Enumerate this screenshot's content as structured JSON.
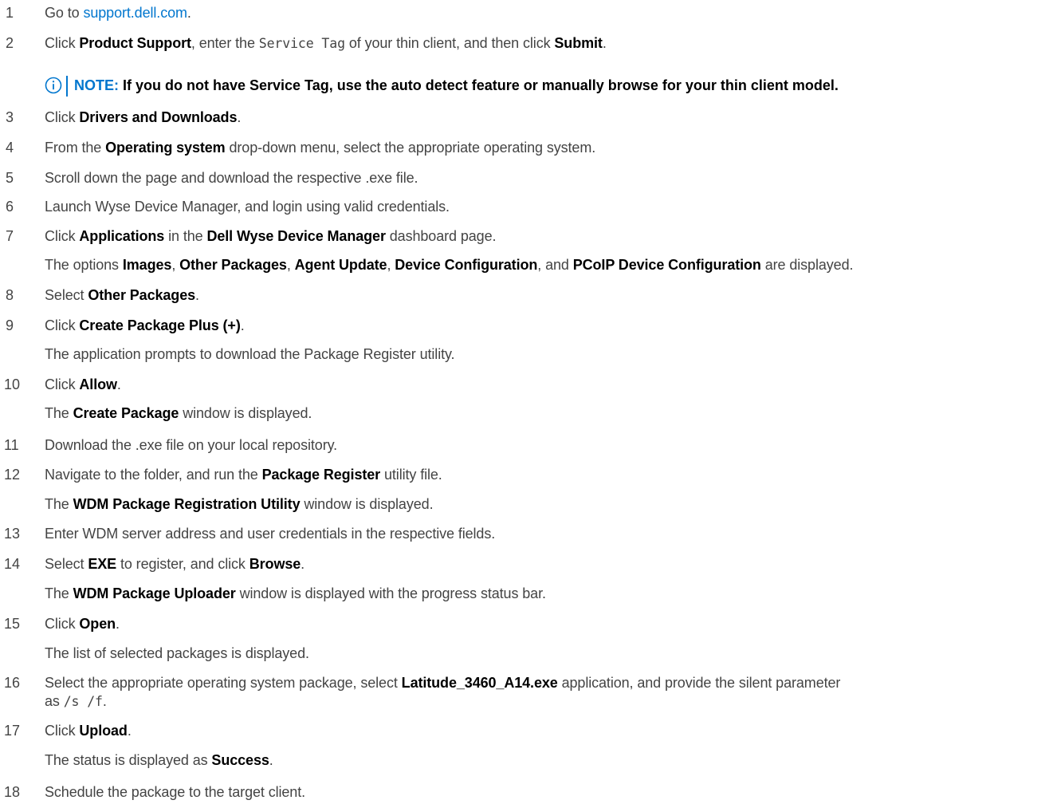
{
  "steps": [
    {
      "n": "1",
      "pre": "Go to ",
      "link": "support.dell.com",
      "post": "."
    },
    {
      "n": "2",
      "a": "Click ",
      "b": "Product Support",
      "c": ", enter the ",
      "code": "Service Tag",
      "d": " of your thin client, and then click ",
      "e": "Submit",
      "f": "."
    },
    {
      "n": "3",
      "a": "Click ",
      "b": "Drivers and Downloads",
      "c": "."
    },
    {
      "n": "4",
      "a": "From the ",
      "b": "Operating system",
      "c": " drop-down menu, select the appropriate operating system."
    },
    {
      "n": "5",
      "a": "Scroll down the page and download the respective .exe file."
    },
    {
      "n": "6",
      "a": "Launch Wyse Device Manager, and login using valid credentials."
    },
    {
      "n": "7",
      "a": "Click ",
      "b": "Applications",
      "c": " in the ",
      "d": "Dell Wyse Device Manager",
      "e": " dashboard page."
    },
    {
      "n": "8",
      "a": "Select ",
      "b": "Other Packages",
      "c": "."
    },
    {
      "n": "9",
      "a": "Click ",
      "b": "Create Package Plus (+)",
      "c": "."
    },
    {
      "n": "10",
      "a": "Click ",
      "b": "Allow",
      "c": "."
    },
    {
      "n": "11",
      "a": "Download the .exe file on your local repository."
    },
    {
      "n": "12",
      "a": "Navigate to the folder, and run the ",
      "b": "Package Register",
      "c": " utility file."
    },
    {
      "n": "13",
      "a": "Enter WDM server address and user credentials in the respective fields."
    },
    {
      "n": "14",
      "a": "Select ",
      "b": "EXE",
      "c": " to register, and click ",
      "d": "Browse",
      "e": "."
    },
    {
      "n": "15",
      "a": "Click ",
      "b": "Open",
      "c": "."
    },
    {
      "n": "16",
      "a": "Select the appropriate operating system package, select ",
      "b": "Latitude_3460_A14.exe",
      "c": " application, and provide the silent parameter",
      "d": "as ",
      "code": "/s /f",
      "e": "."
    },
    {
      "n": "17",
      "a": "Click ",
      "b": "Upload",
      "c": "."
    },
    {
      "n": "18",
      "a": "Schedule the package to the target client."
    }
  ],
  "results": {
    "r7": {
      "a": "The options ",
      "b1": "Images",
      "s1": ", ",
      "b2": "Other Packages",
      "s2": ", ",
      "b3": "Agent Update",
      "s3": ", ",
      "b4": "Device Configuration",
      "s4": ", and ",
      "b5": "PCoIP Device Configuration",
      "s5": " are displayed."
    },
    "r9": {
      "a": "The application prompts to download the Package Register utility."
    },
    "r10": {
      "a": "The ",
      "b": "Create Package",
      "c": " window is displayed."
    },
    "r12": {
      "a": "The ",
      "b": "WDM Package Registration Utility",
      "c": " window is displayed."
    },
    "r14": {
      "a": "The ",
      "b": "WDM Package Uploader",
      "c": " window is displayed with the progress status bar."
    },
    "r15": {
      "a": "The list of selected packages is displayed."
    },
    "r17": {
      "a": "The status is displayed as ",
      "b": "Success",
      "c": "."
    }
  },
  "note": {
    "label": "NOTE:",
    "text": " If you do not have Service Tag, use the auto detect feature or manually browse for your thin client model.",
    "icon": "info-icon",
    "accent": "#0076ce"
  }
}
